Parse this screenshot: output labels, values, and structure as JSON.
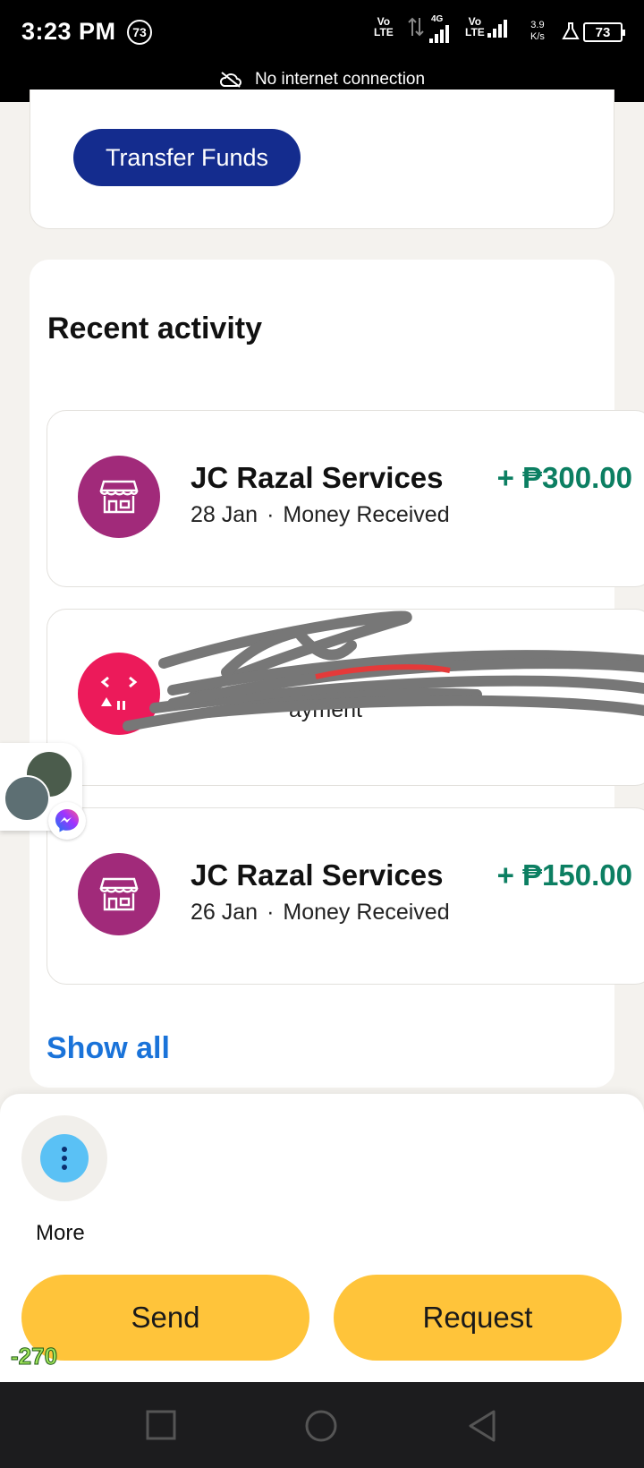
{
  "status_bar": {
    "time": "3:23 PM",
    "notification_count": "73",
    "sim1_label": "Vo\nLTE",
    "network_4g_label": "4G",
    "sim2_label": "Vo\nLTE",
    "speed_value": "3.9",
    "speed_unit": "K/s",
    "battery": "73",
    "no_internet": "No internet connection"
  },
  "top_card": {
    "transfer_button": "Transfer Funds"
  },
  "recent_activity": {
    "title": "Recent activity",
    "transactions": [
      {
        "name": "JC Razal Services",
        "amount": "+ ₱300.00",
        "date": "28 Jan",
        "type": "Money Received",
        "icon": "store-icon"
      },
      {
        "name": "",
        "amount": "",
        "date": "",
        "type": "ayment",
        "icon": "redacted-icon"
      },
      {
        "name": "JC Razal Services",
        "amount": "+ ₱150.00",
        "date": "26 Jan",
        "type": "Money Received",
        "icon": "store-icon"
      }
    ],
    "show_all": "Show all"
  },
  "bottom_sheet": {
    "more_label": "More",
    "send_label": "Send",
    "request_label": "Request"
  },
  "overlay_number": "-270",
  "colors": {
    "brand_blue": "#142c8e",
    "amount_green": "#0c7f62",
    "link_blue": "#1a73d9",
    "action_yellow": "#ffc43a",
    "merchant_purple": "#a12a7a"
  }
}
